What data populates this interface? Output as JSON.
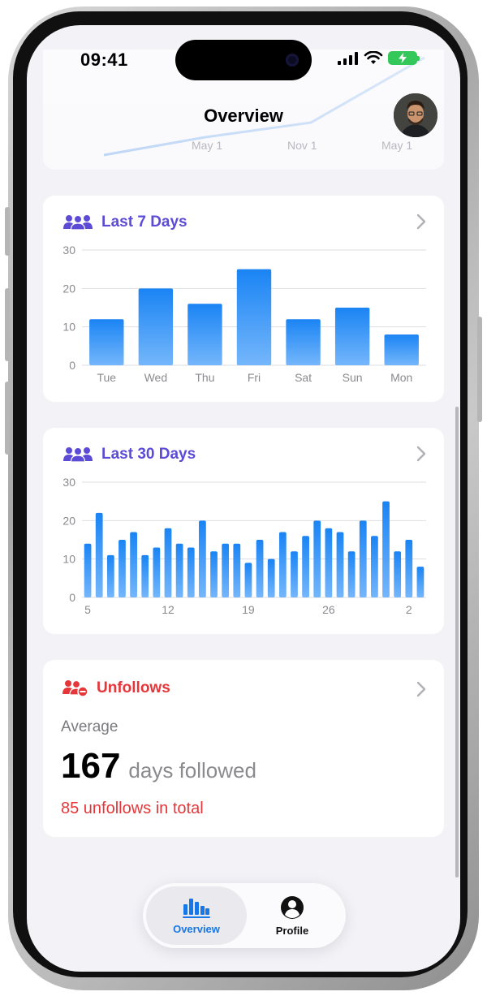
{
  "status_bar": {
    "time": "09:41"
  },
  "header": {
    "title": "Overview",
    "faded_axis_labels": [
      "May 1",
      "Nov 1",
      "May 1"
    ]
  },
  "colors": {
    "accent_purple": "#5b4bd6",
    "bar_blue": "#1e88f5",
    "unfollow_red": "#e5373a",
    "tab_active": "#1877e6"
  },
  "last7": {
    "title": "Last 7 Days",
    "icon": "people-icon",
    "chart_data": {
      "type": "bar",
      "categories": [
        "Tue",
        "Wed",
        "Thu",
        "Fri",
        "Sat",
        "Sun",
        "Mon"
      ],
      "values": [
        12,
        20,
        16,
        25,
        12,
        15,
        8
      ],
      "yticks": [
        "30",
        "20",
        "10",
        "0"
      ],
      "ylim": [
        0,
        30
      ],
      "grid": true
    }
  },
  "last30": {
    "title": "Last 30 Days",
    "icon": "people-icon",
    "chart_data": {
      "type": "bar",
      "x_tick_labels": [
        "5",
        "12",
        "19",
        "26",
        "2"
      ],
      "values": [
        14,
        22,
        11,
        15,
        17,
        11,
        13,
        18,
        14,
        13,
        20,
        12,
        14,
        14,
        9,
        15,
        10,
        17,
        12,
        16,
        20,
        18,
        17,
        12,
        20,
        16,
        25,
        12,
        15,
        8
      ],
      "yticks": [
        "30",
        "20",
        "10",
        "0"
      ],
      "ylim": [
        0,
        30
      ],
      "grid": true
    }
  },
  "unfollows": {
    "title": "Unfollows",
    "icon": "person-minus-icon",
    "average_label": "Average",
    "value": "167",
    "unit": "days followed",
    "total_text": "85 unfollows in total"
  },
  "tabbar": {
    "tabs": [
      {
        "label": "Overview",
        "icon": "bar-chart-icon",
        "active": true
      },
      {
        "label": "Profile",
        "icon": "person-circle-icon",
        "active": false
      }
    ]
  }
}
